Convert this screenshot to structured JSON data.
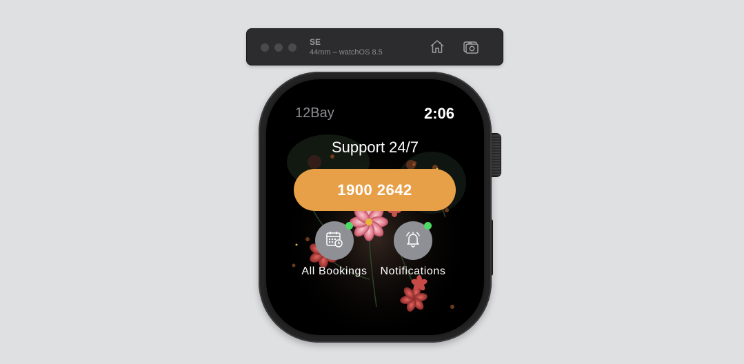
{
  "simulator": {
    "device_name": "SE",
    "device_info": "44mm – watchOS 8.5",
    "icons": [
      "home-icon",
      "screenshot-icon"
    ]
  },
  "watch": {
    "app_name": "12Bay",
    "time": "2:06",
    "support_title": "Support 24/7",
    "phone_number": "1900 2642",
    "actions": [
      {
        "label": "All Bookings",
        "icon": "calendar-clock-icon",
        "badge": true
      },
      {
        "label": "Notifications",
        "icon": "bell-icon",
        "badge": true
      }
    ],
    "colors": {
      "accent": "#e8a048",
      "badge": "#4cd964",
      "circle": "#8e9096",
      "app_name": "#8e8e93"
    }
  }
}
